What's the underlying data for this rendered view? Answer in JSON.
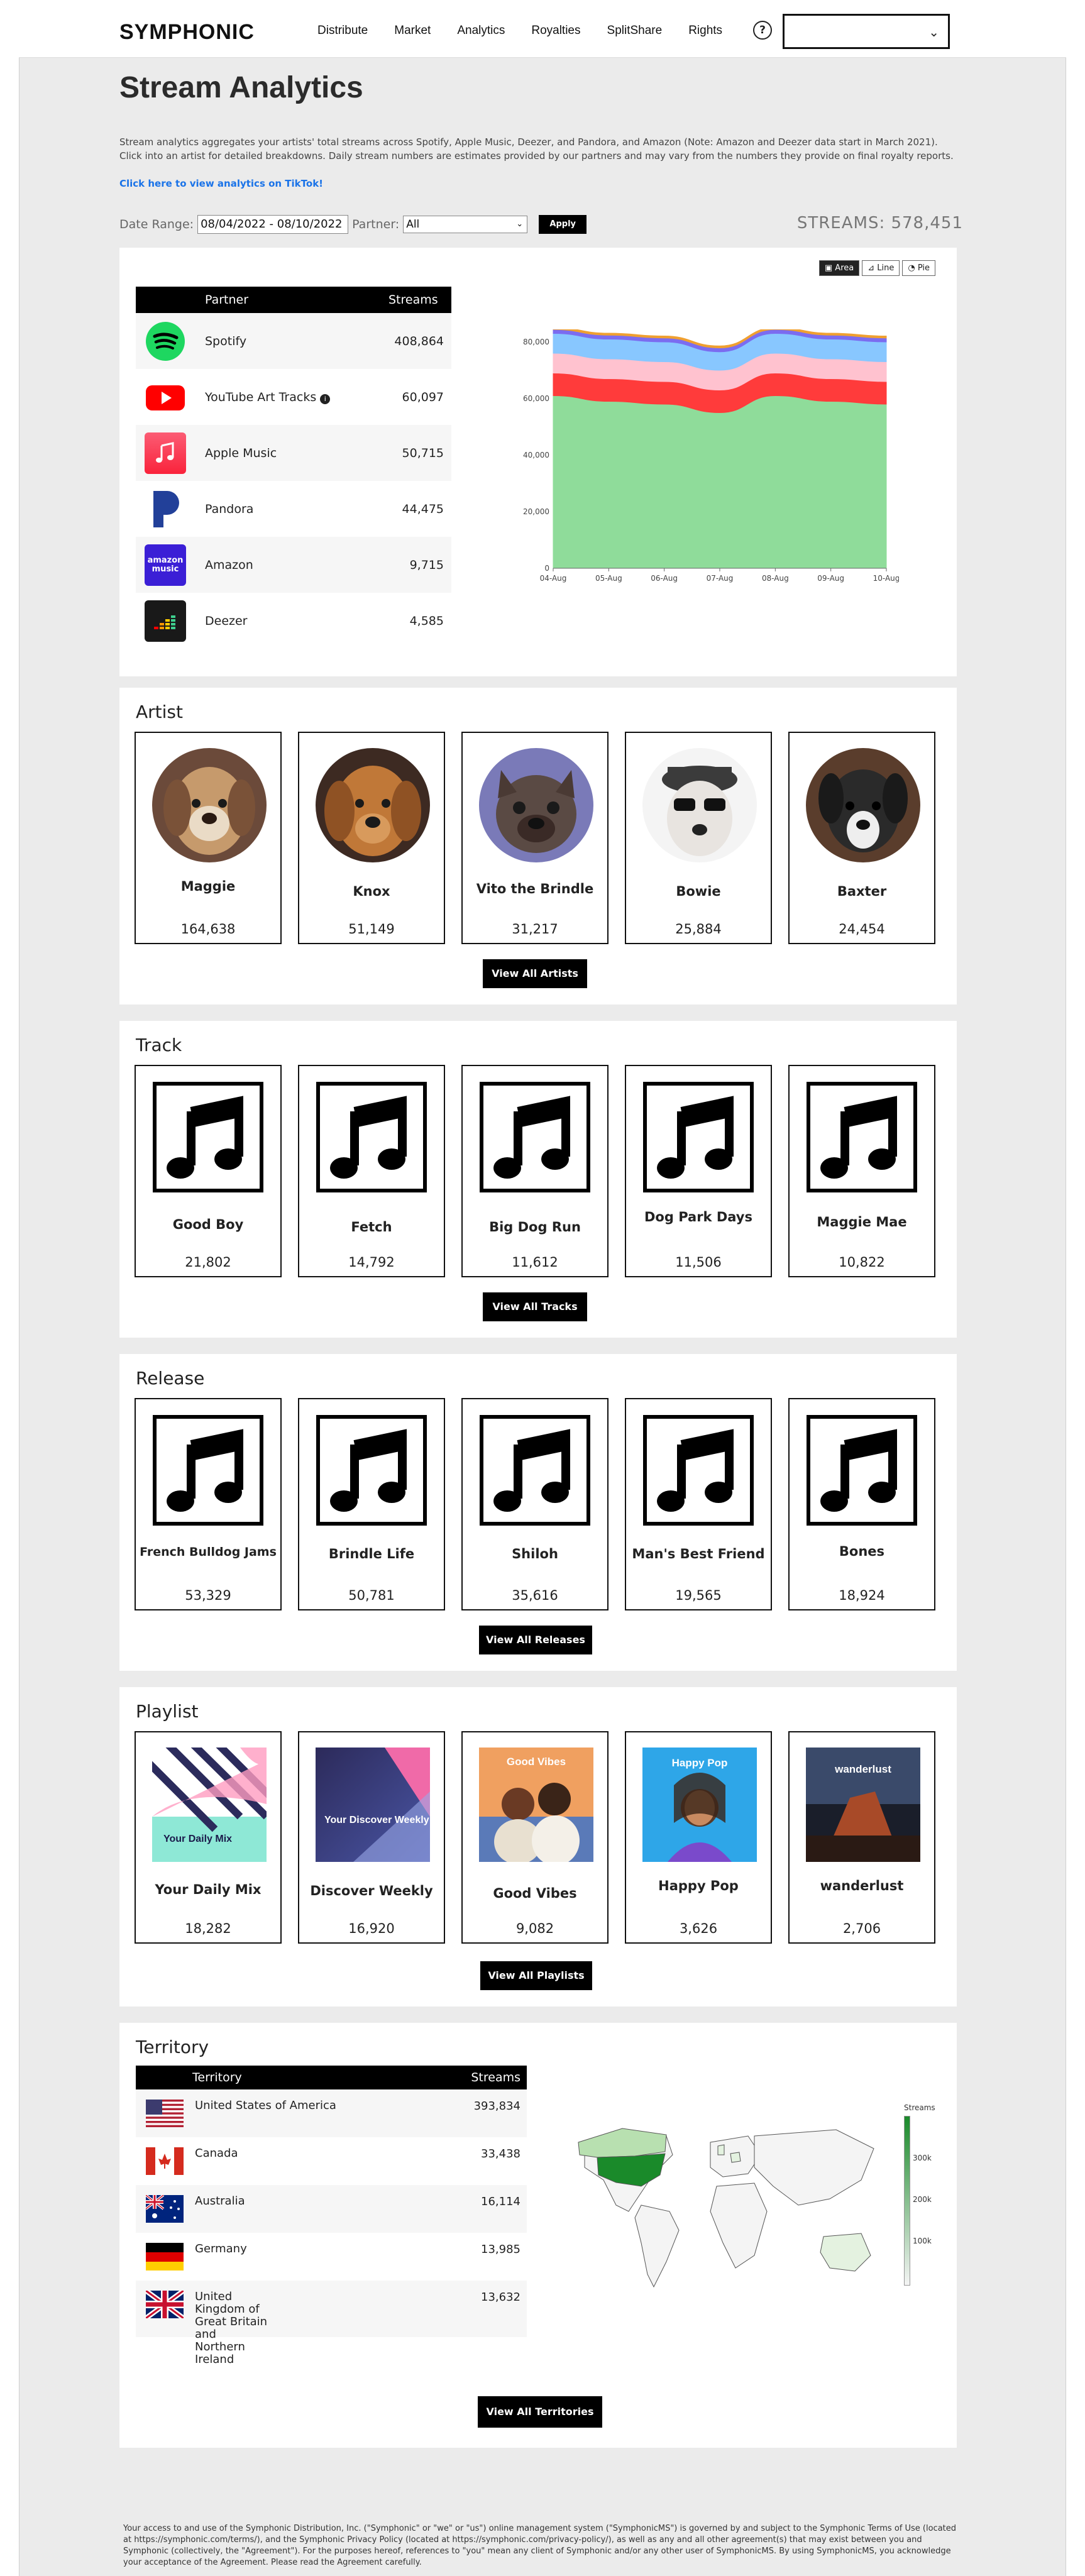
{
  "nav": {
    "logo": "SYMPHONIC",
    "links": [
      "Distribute",
      "Market",
      "Analytics",
      "Royalties",
      "SplitShare",
      "Rights"
    ],
    "help": "?",
    "selector_value": ""
  },
  "page": {
    "title": "Stream Analytics",
    "intro": "Stream analytics aggregates your artists' total streams across Spotify, Apple Music, Deezer, and Pandora, and Amazon (Note: Amazon and Deezer data start in March 2021). Click into an artist for detailed breakdowns. Daily stream numbers are estimates provided by our partners and may vary from the numbers they provide on final royalty reports.",
    "tiktok_link": "Click here to view analytics on TikTok!"
  },
  "filters": {
    "date_label": "Date Range:",
    "date_value": "08/04/2022 - 08/10/2022",
    "partner_label": "Partner:",
    "partner_value": "All",
    "apply": "Apply",
    "streams_total": "STREAMS: 578,451"
  },
  "partners": {
    "col_partner": "Partner",
    "col_streams": "Streams",
    "rows": [
      {
        "name": "Spotify",
        "streams": "408,864",
        "icon": "spotify-icon"
      },
      {
        "name": "YouTube Art Tracks",
        "streams": "60,097",
        "icon": "youtube-icon"
      },
      {
        "name": "Apple Music",
        "streams": "50,715",
        "icon": "apple-music-icon"
      },
      {
        "name": "Pandora",
        "streams": "44,475",
        "icon": "pandora-icon"
      },
      {
        "name": "Amazon",
        "streams": "9,715",
        "icon": "amazon-music-icon"
      },
      {
        "name": "Deezer",
        "streams": "4,585",
        "icon": "deezer-icon"
      }
    ]
  },
  "chart_tabs": [
    "Area",
    "Line",
    "Pie"
  ],
  "chart_data": {
    "type": "area",
    "x": [
      "04-Aug",
      "05-Aug",
      "06-Aug",
      "07-Aug",
      "08-Aug",
      "09-Aug",
      "10-Aug"
    ],
    "ylim": [
      0,
      80000
    ],
    "yticks": [
      "0",
      "20,000",
      "40,000",
      "60,000",
      "80,000"
    ],
    "stacked": true,
    "series": [
      {
        "color": "#8fdc9a",
        "values": [
          61000,
          59000,
          58000,
          55000,
          61000,
          59000,
          58000
        ]
      },
      {
        "color": "#ff3b3b",
        "values": [
          8000,
          8000,
          8000,
          8000,
          8000,
          8000,
          8000
        ]
      },
      {
        "color": "#ffc2cf",
        "values": [
          7000,
          7000,
          7000,
          7000,
          7000,
          7000,
          7000
        ]
      },
      {
        "color": "#88c7ff",
        "values": [
          7000,
          7000,
          7000,
          6500,
          7000,
          7000,
          7000
        ]
      },
      {
        "color": "#7b6cf0",
        "values": [
          1400,
          1400,
          1400,
          1400,
          1400,
          1400,
          1400
        ]
      },
      {
        "color": "#f0a030",
        "values": [
          700,
          700,
          700,
          700,
          700,
          700,
          700
        ]
      }
    ]
  },
  "artists": {
    "title": "Artist",
    "items": [
      {
        "name": "Maggie",
        "value": "164,638"
      },
      {
        "name": "Knox",
        "value": "51,149"
      },
      {
        "name": "Vito the Brindle",
        "value": "31,217"
      },
      {
        "name": "Bowie",
        "value": "25,884"
      },
      {
        "name": "Baxter",
        "value": "24,454"
      }
    ],
    "button": "View All Artists"
  },
  "tracks": {
    "title": "Track",
    "items": [
      {
        "name": "Good Boy",
        "value": "21,802"
      },
      {
        "name": "Fetch",
        "value": "14,792"
      },
      {
        "name": "Big Dog Run",
        "value": "11,612"
      },
      {
        "name": "Dog Park Days",
        "value": "11,506"
      },
      {
        "name": "Maggie Mae",
        "value": "10,822"
      }
    ],
    "button": "View All Tracks"
  },
  "releases": {
    "title": "Release",
    "items": [
      {
        "name": "French Bulldog Jams",
        "value": "53,329"
      },
      {
        "name": "Brindle Life",
        "value": "50,781"
      },
      {
        "name": "Shiloh",
        "value": "35,616"
      },
      {
        "name": "Man's Best Friend",
        "value": "19,565"
      },
      {
        "name": "Bones",
        "value": "18,924"
      }
    ],
    "button": "View All Releases"
  },
  "playlists": {
    "title": "Playlist",
    "items": [
      {
        "name": "Your Daily Mix",
        "value": "18,282",
        "cover_text": "Your Daily Mix"
      },
      {
        "name": "Discover Weekly",
        "value": "16,920",
        "cover_text": "Your Discover Weekly"
      },
      {
        "name": "Good Vibes",
        "value": "9,082",
        "cover_text": "Good Vibes"
      },
      {
        "name": "Happy Pop",
        "value": "3,626",
        "cover_text": "Happy Pop"
      },
      {
        "name": "wanderlust",
        "value": "2,706",
        "cover_text": "wanderlust"
      }
    ],
    "button": "View All Playlists"
  },
  "territories": {
    "title": "Territory",
    "col_territory": "Territory",
    "col_streams": "Streams",
    "rows": [
      {
        "name": "United States of America",
        "streams": "393,834",
        "flag": "us-flag"
      },
      {
        "name": "Canada",
        "streams": "33,438",
        "flag": "canada-flag"
      },
      {
        "name": "Australia",
        "streams": "16,114",
        "flag": "australia-flag"
      },
      {
        "name": "Germany",
        "streams": "13,985",
        "flag": "germany-flag"
      },
      {
        "name": "United Kingdom of Great Britain and Northern Ireland",
        "streams": "13,632",
        "flag": "uk-flag"
      }
    ],
    "legend_title": "Streams",
    "legend_ticks": [
      "300k",
      "200k",
      "100k"
    ],
    "button": "View All Territories"
  },
  "footer": "Your access to and use of the Symphonic Distribution, Inc. (\"Symphonic\" or \"we\" or \"us\") online management system (\"SymphonicMS\") is governed by and subject to the Symphonic Terms of Use (located at https://symphonic.com/terms/), and the Symphonic Privacy Policy (located at https://symphonic.com/privacy-policy/), as well as any and all other agreement(s) that may exist between you and Symphonic (collectively, the \"Agreement\"). For the purposes hereof, references to \"you\" mean any client of Symphonic and/or any other user of SymphonicMS. By using SymphonicMS, you acknowledge your acceptance of the Agreement. Please read the Agreement carefully."
}
